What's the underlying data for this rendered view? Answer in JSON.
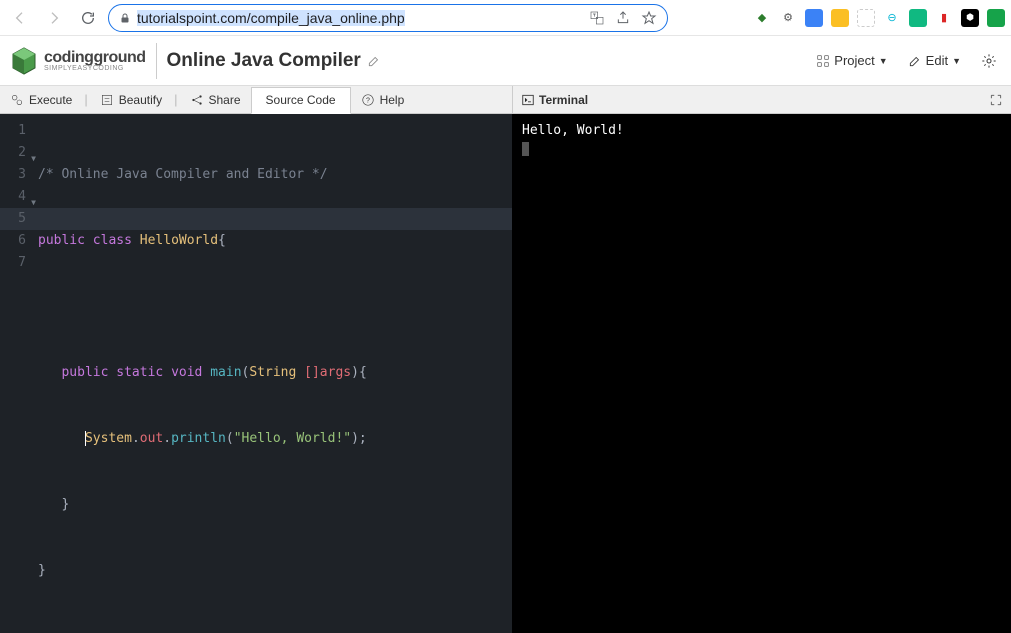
{
  "browser": {
    "url_host": "tutorialspoint.com",
    "url_path": "/compile_java_online.php"
  },
  "header": {
    "logo_main": "codingground",
    "logo_sub": "SIMPLYEASYCODING",
    "title": "Online Java Compiler",
    "project_btn": "Project",
    "edit_btn": "Edit"
  },
  "toolbar": {
    "execute": "Execute",
    "beautify": "Beautify",
    "share": "Share",
    "source_tab": "Source Code",
    "help": "Help",
    "terminal_label": "Terminal"
  },
  "editor": {
    "lines": [
      "1",
      "2",
      "3",
      "4",
      "5",
      "6",
      "7"
    ],
    "code": {
      "l1_comment": "/* Online Java Compiler and Editor */",
      "l2_kw1": "public",
      "l2_kw2": "class",
      "l2_cls": "HelloWorld",
      "l2_brace": "{",
      "l4_kw1": "public",
      "l4_kw2": "static",
      "l4_kw3": "void",
      "l4_fn": "main",
      "l4_paren": "(",
      "l4_type": "String",
      "l4_args": " []args",
      "l4_close": "){",
      "l5_sys": "System",
      "l5_dot1": ".",
      "l5_out": "out",
      "l5_dot2": ".",
      "l5_pln": "println",
      "l5_op": "(",
      "l5_str": "\"Hello, World!\"",
      "l5_cl": ");",
      "l6_brace": "}",
      "l7_brace": "}"
    }
  },
  "terminal": {
    "output": "Hello, World!"
  }
}
